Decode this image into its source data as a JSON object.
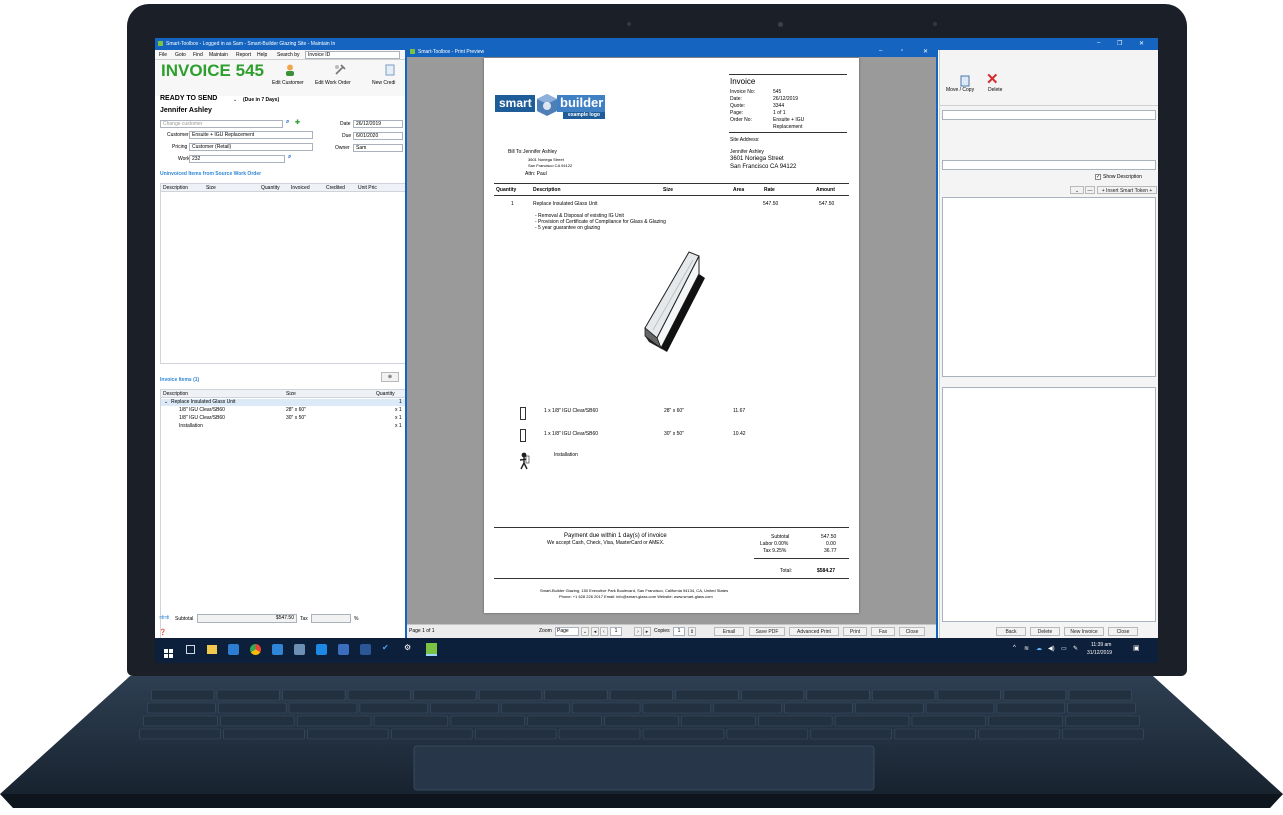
{
  "main_window": {
    "title": "Smart-Toolbox - Logged in as Sam - Smart-Builder Glazing Site - Maintain In",
    "menu": [
      "File",
      "Goto",
      "Find",
      "Maintain",
      "Report",
      "Help"
    ],
    "search_label": "Search by",
    "search_value": "Invoice ID",
    "invoice_title": "INVOICE 545",
    "status": "READY TO SEND",
    "status_due": "(Due in 7 Days)",
    "toolbar_buttons": [
      "Edit Customer",
      "Edit Work Order",
      "New Credi"
    ],
    "customer_name": "Jennifer Ashley",
    "change_customer_placeholder": "Change customer",
    "customer_ref_label": "Customer Ref",
    "customer_ref_value": "Ensuite + IGU Replacement",
    "pricing_label": "Pricing",
    "pricing_value": "Customer (Retail)",
    "work_id_label": "Work ID",
    "work_id_value": "232",
    "date_label": "Date",
    "date_value": "26/12/2019",
    "due_label": "Due",
    "due_value": "6/01/2020",
    "owner_label": "Owner",
    "owner_value": "Sam",
    "uninvoiced_heading": "Uninvoiced Items from Source Work Order",
    "uninvoiced_columns": [
      "Description",
      "Size",
      "Quantity",
      "Invoiced",
      "Credited",
      "Unit Pric"
    ],
    "invoice_items_heading": "Invoice Items (1)",
    "invoice_items_columns": [
      "Description",
      "Size",
      "Quantity"
    ],
    "invoice_items": [
      {
        "desc": "Replace Insulated Glass Unit",
        "size": "",
        "qty": "1"
      },
      {
        "desc": "1/8\" IGU Clear/SB60",
        "size": "28\" x 60\"",
        "qty": "x 1"
      },
      {
        "desc": "1/8\" IGU Clear/SB60",
        "size": "30\" x 50\"",
        "qty": "x 1"
      },
      {
        "desc": "Installation",
        "size": "",
        "qty": "x 1"
      }
    ],
    "subtotal_label": "Subtotal",
    "subtotal_value": "$547.50",
    "tax_label": "Tax",
    "percent_sign": "%"
  },
  "right_pane": {
    "buttons": [
      "Move / Copy",
      "Delete"
    ],
    "show_description": "Show Description",
    "insert_token": "+ Insert Smart Token +",
    "bottom_buttons": [
      "Back",
      "Delete",
      "New Invoice",
      "Close"
    ]
  },
  "preview_window": {
    "title": "Smart-Toolbox - Print Preview",
    "page_status": "Page 1 of 1",
    "zoom_label": "Zoom",
    "zoom_value": "Page",
    "page_num": "1",
    "copies_label": "Copies",
    "copies_value": "1",
    "buttons": [
      "Email",
      "Save PDF",
      "Advanced Print",
      "Print",
      "Fax",
      "Close"
    ]
  },
  "invoice_doc": {
    "logo_smart": "smart",
    "logo_builder": "builder",
    "logo_example": "example logo",
    "heading": "Invoice",
    "meta": [
      {
        "label": "Invoice No:",
        "value": "545"
      },
      {
        "label": "Date:",
        "value": "26/12/2019"
      },
      {
        "label": "Quote:",
        "value": "3344"
      },
      {
        "label": "Page:",
        "value": "1 of 1"
      },
      {
        "label": "Order No:",
        "value": "Ensuite + IGU"
      },
      {
        "label": "",
        "value": "Replacement"
      }
    ],
    "site_address_label": "Site Address:",
    "site_address": [
      "Jennifer Ashley",
      "3601 Noriega Street",
      "San Francisco  CA  94122"
    ],
    "bill_to_label": "Bill To:",
    "bill_to_name": "Jennifer Ashley",
    "bill_to_street": "3601 Noriega Street",
    "bill_to_city": "San Francisco  CA  94122",
    "attn": "Attn: Paul",
    "table_headers": [
      "Quantity",
      "Description",
      "Size",
      "Area",
      "Rate",
      "Amount"
    ],
    "line_qty": "1",
    "line_desc": "Replace Insulated Glass Unit",
    "line_rate": "547.50",
    "line_amount": "547.50",
    "bullets": [
      "- Removal & Disposal of existing IG Unit",
      "- Provision of Certificate of Compliance for Glass & Glazing",
      "- 5 year guarantee on glazing"
    ],
    "components": [
      {
        "desc": "1 x  1/8\" IGU Clear/SB60",
        "size": "28\" x 60\"",
        "area": "11.67"
      },
      {
        "desc": "1 x  1/8\" IGU Clear/SB60",
        "size": "30\" x 50\"",
        "area": "10.42"
      }
    ],
    "installation": "Installation",
    "payment_line1": "Payment due within 1 day(s) of invoice",
    "payment_line2": "We accept Cash, Check, Visa, MasterCard or AMEX.",
    "totals": [
      {
        "label": "Subtotal",
        "value": "547.50"
      },
      {
        "label": "Labor 0.00%",
        "value": "0.00"
      },
      {
        "label": "Tax 9.25%",
        "value": "36.77"
      }
    ],
    "total_label": "Total:",
    "total_value": "$584.27",
    "footer_line1": "Smart-Builder Glazing, 150 Executive Park Boulevard, San Francisco, California 94134, CA, United States",
    "footer_line2": "Phone: +1 628 226 2017  Email: info@smart-glass.com  Website: www.smart-glass.com"
  },
  "taskbar": {
    "time": "11:39 am",
    "date": "31/12/2019"
  },
  "colors": {
    "title_blue": "#1565c0",
    "invoice_green": "#2e9e2e",
    "link_blue": "#2f86d6",
    "delete_red": "#d32f2f"
  }
}
